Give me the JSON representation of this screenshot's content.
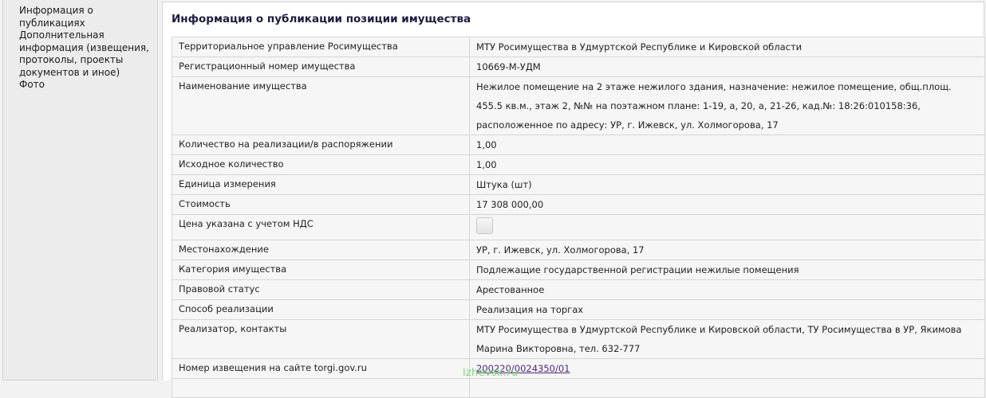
{
  "sidebar": {
    "items": [
      {
        "label": "Информация о публикациях"
      },
      {
        "label": "Дополнительная информация (извещения, протоколы, проекты документов и иное)"
      },
      {
        "label": "Фото"
      }
    ]
  },
  "main": {
    "title": "Информация о публикации позиции имущества",
    "rows": [
      {
        "label": "Территориальное управление Росимущества",
        "value": "МТУ Росимущества в Удмуртской Республике и Кировской области"
      },
      {
        "label": "Регистрационный номер имущества",
        "value": "10669-М-УДМ"
      },
      {
        "label": "Наименование имущества",
        "value": "Нежилое помещение на 2 этаже нежилого здания, назначение: нежилое помещение, общ.площ. 455.5 кв.м., этаж 2, №№ на поэтажном плане: 1-19, а, 20, а, 21-26, кад.№: 18:26:010158:36, расположенное по адресу: УР, г. Ижевск, ул. Холмогорова, 17"
      },
      {
        "label": "Количество на реализации/в распоряжении",
        "value": "1,00"
      },
      {
        "label": "Исходное количество",
        "value": "1,00"
      },
      {
        "label": "Единица измерения",
        "value": "Штука (шт)"
      },
      {
        "label": "Стоимость",
        "value": "17 308 000,00"
      },
      {
        "label": "Цена указана с учетом НДС",
        "checked": false
      },
      {
        "label": "Местонахождение",
        "value": "УР, г. Ижевск, ул. Холмогорова, 17"
      },
      {
        "label": "Категория имущества",
        "value": "Подлежащие государственной регистрации нежилые помещения"
      },
      {
        "label": "Правовой статус",
        "value": "Арестованное"
      },
      {
        "label": "Способ реализации",
        "value": "Реализация на торгах"
      },
      {
        "label": "Реализатор, контакты",
        "value": "МТУ Росимущества в Удмуртской Республике и Кировской области, ТУ Росимущества в УР, Якимова Марина Викторовна, тел. 632-777"
      },
      {
        "label": "Номер извещения на сайте torgi.gov.ru",
        "value": "200220/0024350/01"
      }
    ]
  },
  "watermark": "izhevsk.ru"
}
